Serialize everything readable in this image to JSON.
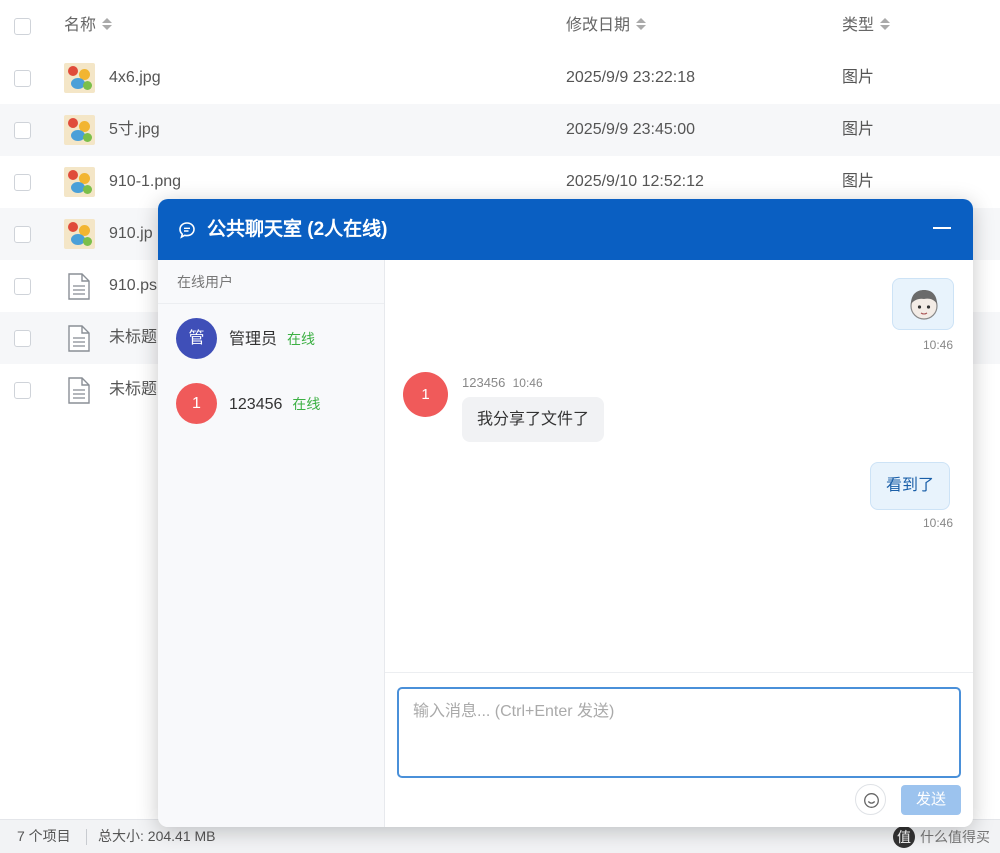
{
  "file_list": {
    "columns": {
      "name": "名称",
      "date": "修改日期",
      "type": "类型"
    },
    "rows": [
      {
        "name": "4x6.jpg",
        "date": "2025/9/9 23:22:18",
        "type": "图片",
        "icon": "image-thumbnail-icon"
      },
      {
        "name": "5寸.jpg",
        "date": "2025/9/9 23:45:00",
        "type": "图片",
        "icon": "image-thumbnail-icon"
      },
      {
        "name": "910-1.png",
        "date": "2025/9/10 12:52:12",
        "type": "图片",
        "icon": "image-thumbnail-icon"
      },
      {
        "name": "910.jp",
        "date": "",
        "type": "",
        "icon": "image-thumbnail-icon"
      },
      {
        "name": "910.ps",
        "date": "",
        "type": "",
        "icon": "document-icon"
      },
      {
        "name": "未标题",
        "date": "",
        "type": "",
        "icon": "document-icon"
      },
      {
        "name": "未标题",
        "date": "",
        "type": "",
        "icon": "document-icon"
      }
    ]
  },
  "status_bar": {
    "count": "7 个项目",
    "total_size": "总大小: 204.41 MB",
    "watermark": "什么值得买",
    "watermark_logo": "值"
  },
  "chat": {
    "title": "公共聊天室 (2人在线)",
    "sidebar_title": "在线用户",
    "users": [
      {
        "avatar": "管",
        "name": "管理员",
        "status": "在线",
        "color": "#3f4fb8"
      },
      {
        "avatar": "1",
        "name": "123456",
        "status": "在线",
        "color": "#f05a5a"
      }
    ],
    "messages": [
      {
        "self": true,
        "kind": "sticker",
        "time": "10:46"
      },
      {
        "self": false,
        "avatar": "1",
        "sender": "123456",
        "time": "10:46",
        "text": "我分享了文件了"
      },
      {
        "self": true,
        "text": "看到了",
        "time": "10:46"
      }
    ],
    "input_placeholder": "输入消息... (Ctrl+Enter 发送)",
    "send_label": "发送"
  },
  "colors": {
    "header_bg": "#0a5fc2",
    "online": "#3cb043",
    "send_btn": "#9cc3ee",
    "self_bubble": "#e8f3fc"
  }
}
